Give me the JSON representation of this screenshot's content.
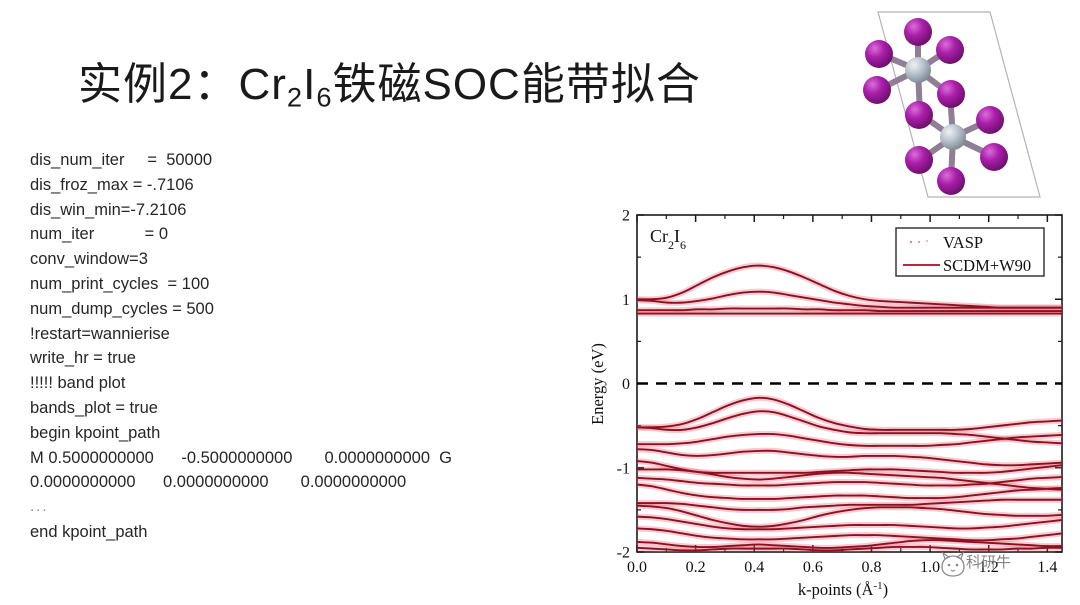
{
  "slide": {
    "background_color": "#ffffff",
    "title": {
      "prefix": "实例2：Cr",
      "sub1": "2",
      "mid": "I",
      "sub2": "6",
      "suffix": "铁磁SOC能带拟合",
      "full_text": "实例2：Cr2I6铁磁SOC能带拟合",
      "color": "#1a1a1a"
    }
  },
  "code_block": {
    "lines": [
      "dis_num_iter     =  50000",
      "dis_froz_max = -.7106",
      "dis_win_min=-7.2106",
      "num_iter           = 0",
      "conv_window=3",
      "num_print_cycles  = 100",
      "num_dump_cycles = 500",
      "!restart=wannierise",
      "write_hr = true",
      "!!!!! band plot",
      "bands_plot = true",
      "begin kpoint_path",
      "M 0.5000000000      -0.5000000000       0.0000000000  G",
      "0.0000000000      0.0000000000       0.0000000000",
      "...",
      "end kpoint_path"
    ],
    "text_color": "#262626"
  },
  "crystal_figure": {
    "name": "Cr2I6 unit cell structure",
    "cr_atom_color": "#b8c0c8",
    "i_atom_color": "#a41ba4",
    "bond_color": "#8f7f94",
    "cell_line_color": "#b0a8b4",
    "cr_atom_count": 2,
    "i_atom_count": 12
  },
  "chart_data": {
    "type": "line",
    "title": "",
    "annotation": "Cr2I6",
    "annotation_parts": {
      "prefix": "Cr",
      "sub1": "2",
      "mid": "I",
      "sub2": "6"
    },
    "xlabel": "k-points (Å-1)",
    "xlabel_parts": {
      "base": "k-points (Å",
      "sup": "-1",
      "tail": ")"
    },
    "ylabel": "Energy (eV)",
    "xlim": [
      0.0,
      1.45
    ],
    "ylim": [
      -2,
      2
    ],
    "xticks": [
      0.0,
      0.2,
      0.4,
      0.6,
      0.8,
      1.0,
      1.2,
      1.4
    ],
    "xticklabels": [
      "0.0",
      "0.2",
      "0.4",
      "0.6",
      "0.8",
      "1.0",
      "1.2",
      "1.4"
    ],
    "yticks": [
      -2,
      -1,
      0,
      1,
      2
    ],
    "yticklabels": [
      "-2",
      "-1",
      "0",
      "1",
      "2"
    ],
    "minor_ytick_step": 0.5,
    "minor_xtick_step": 0.1,
    "grid": false,
    "fermi_level": 0,
    "fermi_line_style": "dashed",
    "fermi_line_color": "#000000",
    "legend": {
      "position": "top-right",
      "entries": [
        {
          "label": "VASP",
          "style": "dots",
          "color": "#c84a5a"
        },
        {
          "label": "SCDM+W90",
          "style": "line",
          "color": "#c0243a"
        }
      ]
    },
    "band_line_color": "#8c1020",
    "band_halo_color": "#e8536b",
    "bands": [
      {
        "name": "c4",
        "values": [
          1.0,
          1.0,
          1.02,
          1.08,
          1.17,
          1.26,
          1.33,
          1.38,
          1.4,
          1.38,
          1.33,
          1.26,
          1.18,
          1.1,
          1.04,
          1.0,
          0.98,
          0.97,
          0.96,
          0.95,
          0.94,
          0.93,
          0.92,
          0.91,
          0.9,
          0.9,
          0.9,
          0.9,
          0.9
        ]
      },
      {
        "name": "c3",
        "values": [
          0.99,
          0.98,
          0.96,
          0.96,
          0.98,
          1.01,
          1.05,
          1.08,
          1.09,
          1.08,
          1.05,
          1.02,
          0.99,
          0.96,
          0.94,
          0.92,
          0.91,
          0.9,
          0.9,
          0.9,
          0.9,
          0.9,
          0.9,
          0.9,
          0.9,
          0.9,
          0.9,
          0.9,
          0.9
        ]
      },
      {
        "name": "c2",
        "values": [
          0.87,
          0.87,
          0.87,
          0.87,
          0.88,
          0.88,
          0.89,
          0.89,
          0.89,
          0.89,
          0.89,
          0.88,
          0.88,
          0.87,
          0.87,
          0.87,
          0.86,
          0.86,
          0.86,
          0.86,
          0.86,
          0.86,
          0.86,
          0.86,
          0.86,
          0.86,
          0.86,
          0.86,
          0.86
        ]
      },
      {
        "name": "c1",
        "values": [
          0.83,
          0.83,
          0.83,
          0.83,
          0.83,
          0.83,
          0.83,
          0.83,
          0.83,
          0.83,
          0.83,
          0.83,
          0.83,
          0.83,
          0.83,
          0.83,
          0.83,
          0.83,
          0.83,
          0.83,
          0.83,
          0.83,
          0.83,
          0.83,
          0.83,
          0.83,
          0.83,
          0.83,
          0.83
        ]
      },
      {
        "name": "v1",
        "values": [
          -0.52,
          -0.52,
          -0.51,
          -0.48,
          -0.42,
          -0.34,
          -0.26,
          -0.2,
          -0.17,
          -0.19,
          -0.25,
          -0.33,
          -0.41,
          -0.47,
          -0.51,
          -0.54,
          -0.55,
          -0.55,
          -0.55,
          -0.55,
          -0.55,
          -0.55,
          -0.54,
          -0.52,
          -0.5,
          -0.48,
          -0.46,
          -0.45,
          -0.44
        ]
      },
      {
        "name": "v2",
        "values": [
          -0.52,
          -0.53,
          -0.55,
          -0.55,
          -0.52,
          -0.47,
          -0.41,
          -0.36,
          -0.33,
          -0.34,
          -0.39,
          -0.45,
          -0.51,
          -0.55,
          -0.58,
          -0.59,
          -0.59,
          -0.59,
          -0.59,
          -0.59,
          -0.59,
          -0.6,
          -0.61,
          -0.63,
          -0.65,
          -0.67,
          -0.69,
          -0.7,
          -0.71
        ]
      },
      {
        "name": "v3",
        "values": [
          -0.72,
          -0.72,
          -0.72,
          -0.71,
          -0.69,
          -0.66,
          -0.63,
          -0.61,
          -0.6,
          -0.6,
          -0.62,
          -0.65,
          -0.68,
          -0.71,
          -0.73,
          -0.74,
          -0.74,
          -0.74,
          -0.74,
          -0.74,
          -0.73,
          -0.72,
          -0.7,
          -0.68,
          -0.66,
          -0.64,
          -0.63,
          -0.62,
          -0.61
        ]
      },
      {
        "name": "v4",
        "values": [
          -0.78,
          -0.79,
          -0.82,
          -0.85,
          -0.86,
          -0.85,
          -0.83,
          -0.81,
          -0.8,
          -0.8,
          -0.82,
          -0.84,
          -0.86,
          -0.87,
          -0.87,
          -0.86,
          -0.86,
          -0.86,
          -0.87,
          -0.88,
          -0.9,
          -0.92,
          -0.94,
          -0.96,
          -0.97,
          -0.97,
          -0.96,
          -0.95,
          -0.94
        ]
      },
      {
        "name": "v5",
        "values": [
          -0.92,
          -0.94,
          -0.98,
          -1.02,
          -1.05,
          -1.06,
          -1.06,
          -1.06,
          -1.06,
          -1.06,
          -1.06,
          -1.06,
          -1.05,
          -1.04,
          -1.03,
          -1.02,
          -1.02,
          -1.02,
          -1.03,
          -1.04,
          -1.05,
          -1.06,
          -1.06,
          -1.06,
          -1.05,
          -1.03,
          -1.01,
          -0.99,
          -0.97
        ]
      },
      {
        "name": "v6",
        "values": [
          -1.02,
          -1.02,
          -1.02,
          -1.03,
          -1.05,
          -1.08,
          -1.11,
          -1.13,
          -1.14,
          -1.13,
          -1.11,
          -1.09,
          -1.07,
          -1.06,
          -1.06,
          -1.07,
          -1.08,
          -1.09,
          -1.1,
          -1.11,
          -1.12,
          -1.14,
          -1.16,
          -1.18,
          -1.2,
          -1.22,
          -1.24,
          -1.25,
          -1.26
        ]
      },
      {
        "name": "v7",
        "values": [
          -1.12,
          -1.13,
          -1.14,
          -1.16,
          -1.18,
          -1.19,
          -1.2,
          -1.21,
          -1.21,
          -1.21,
          -1.2,
          -1.19,
          -1.18,
          -1.17,
          -1.17,
          -1.17,
          -1.18,
          -1.19,
          -1.2,
          -1.21,
          -1.21,
          -1.21,
          -1.2,
          -1.19,
          -1.17,
          -1.15,
          -1.13,
          -1.12,
          -1.11
        ]
      },
      {
        "name": "v8",
        "values": [
          -1.2,
          -1.22,
          -1.26,
          -1.3,
          -1.33,
          -1.35,
          -1.36,
          -1.37,
          -1.37,
          -1.37,
          -1.36,
          -1.35,
          -1.34,
          -1.33,
          -1.33,
          -1.33,
          -1.34,
          -1.35,
          -1.36,
          -1.36,
          -1.36,
          -1.35,
          -1.33,
          -1.31,
          -1.29,
          -1.27,
          -1.26,
          -1.25,
          -1.24
        ]
      },
      {
        "name": "v9",
        "values": [
          -1.42,
          -1.42,
          -1.42,
          -1.43,
          -1.45,
          -1.47,
          -1.49,
          -1.5,
          -1.5,
          -1.5,
          -1.49,
          -1.47,
          -1.46,
          -1.45,
          -1.44,
          -1.44,
          -1.44,
          -1.44,
          -1.44,
          -1.43,
          -1.42,
          -1.41,
          -1.4,
          -1.39,
          -1.38,
          -1.38,
          -1.38,
          -1.38,
          -1.38
        ]
      },
      {
        "name": "v10",
        "values": [
          -1.45,
          -1.46,
          -1.48,
          -1.52,
          -1.57,
          -1.62,
          -1.66,
          -1.69,
          -1.7,
          -1.69,
          -1.66,
          -1.62,
          -1.57,
          -1.53,
          -1.5,
          -1.48,
          -1.47,
          -1.47,
          -1.47,
          -1.48,
          -1.49,
          -1.51,
          -1.53,
          -1.55,
          -1.56,
          -1.57,
          -1.57,
          -1.57,
          -1.56
        ]
      },
      {
        "name": "v11",
        "values": [
          -1.58,
          -1.59,
          -1.61,
          -1.64,
          -1.67,
          -1.7,
          -1.72,
          -1.73,
          -1.73,
          -1.73,
          -1.72,
          -1.71,
          -1.7,
          -1.69,
          -1.68,
          -1.68,
          -1.68,
          -1.68,
          -1.69,
          -1.7,
          -1.71,
          -1.72,
          -1.72,
          -1.71,
          -1.7,
          -1.68,
          -1.66,
          -1.64,
          -1.62
        ]
      },
      {
        "name": "v12",
        "values": [
          -1.72,
          -1.73,
          -1.75,
          -1.78,
          -1.81,
          -1.83,
          -1.84,
          -1.85,
          -1.85,
          -1.85,
          -1.84,
          -1.83,
          -1.82,
          -1.81,
          -1.8,
          -1.8,
          -1.8,
          -1.81,
          -1.82,
          -1.83,
          -1.84,
          -1.85,
          -1.86,
          -1.86,
          -1.85,
          -1.84,
          -1.82,
          -1.8,
          -1.78
        ]
      },
      {
        "name": "v13",
        "values": [
          -1.88,
          -1.89,
          -1.91,
          -1.93,
          -1.94,
          -1.94,
          -1.93,
          -1.92,
          -1.91,
          -1.92,
          -1.93,
          -1.94,
          -1.95,
          -1.95,
          -1.94,
          -1.93,
          -1.91,
          -1.89,
          -1.87,
          -1.86,
          -1.86,
          -1.87,
          -1.88,
          -1.89,
          -1.9,
          -1.91,
          -1.92,
          -1.93,
          -1.93
        ]
      },
      {
        "name": "v14",
        "values": [
          -1.95,
          -1.96,
          -1.97,
          -1.98,
          -1.98,
          -1.97,
          -1.96,
          -1.96,
          -1.96,
          -1.96,
          -1.96,
          -1.97,
          -1.98,
          -1.98,
          -1.97,
          -1.96,
          -1.95,
          -1.94,
          -1.94,
          -1.94,
          -1.95,
          -1.96,
          -1.97,
          -1.97,
          -1.97,
          -1.96,
          -1.96,
          -1.95,
          -1.95
        ]
      }
    ]
  },
  "watermark": {
    "text": "科研牛",
    "color": "#6f6f6f"
  }
}
